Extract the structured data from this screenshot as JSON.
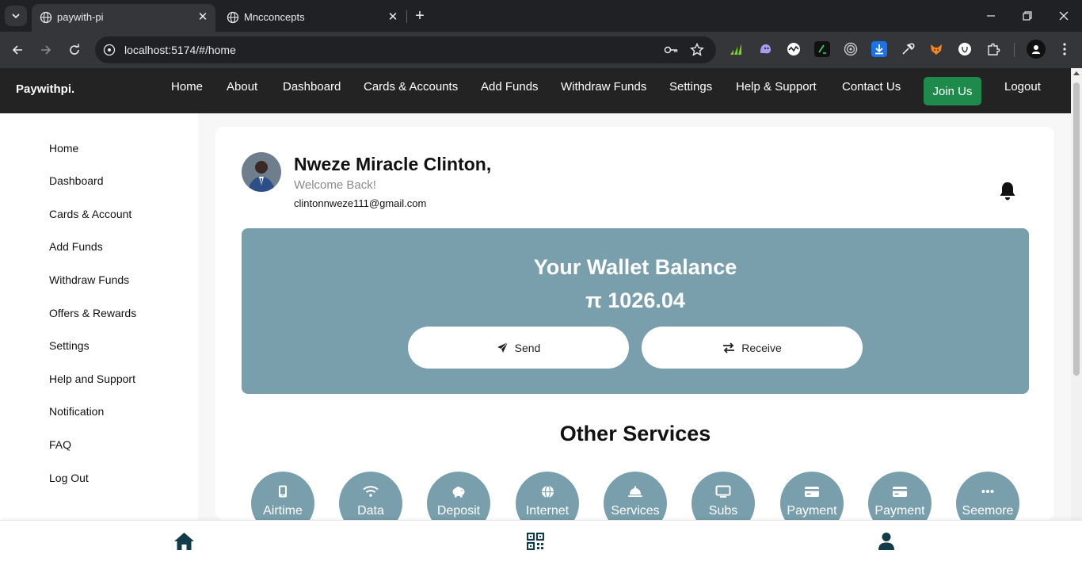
{
  "browser": {
    "tabs": [
      {
        "title": "paywith-pi",
        "active": true
      },
      {
        "title": "Mncconcepts",
        "active": false
      }
    ],
    "url_host": "localhost:5174",
    "url_path": "/#/home"
  },
  "nav": {
    "brand": "Paywithpi.",
    "links": [
      "Home",
      "About",
      "Dashboard",
      "Cards & Accounts",
      "Add Funds",
      "Withdraw Funds",
      "Settings",
      "Help & Support",
      "Contact Us"
    ],
    "join": "Join Us",
    "logout": "Logout"
  },
  "sidebar": {
    "items": [
      "Home",
      "Dashboard",
      "Cards & Account",
      "Add Funds",
      "Withdraw Funds",
      "Offers & Rewards",
      "Settings",
      "Help and Support",
      "Notification",
      "FAQ",
      "Log Out"
    ]
  },
  "user": {
    "name": "Nweze Miracle Clinton,",
    "welcome": "Welcome Back!",
    "email": "clintonnweze111@gmail.com"
  },
  "wallet": {
    "title": "Your Wallet Balance",
    "amount": "π 1026.04",
    "send": "Send",
    "receive": "Receive"
  },
  "services": {
    "title": "Other Services",
    "items": [
      {
        "label": "Airtime",
        "icon": "mobile-icon"
      },
      {
        "label": "Data",
        "icon": "wifi-icon"
      },
      {
        "label": "Deposit",
        "icon": "piggy-bank-icon"
      },
      {
        "label": "Internet",
        "icon": "globe-icon"
      },
      {
        "label": "Services",
        "icon": "service-bell-icon"
      },
      {
        "label": "Subs",
        "icon": "tv-icon"
      },
      {
        "label": "Payment",
        "icon": "credit-card-icon"
      },
      {
        "label": "Payment",
        "icon": "credit-card-icon"
      },
      {
        "label": "Seemore",
        "icon": "ellipsis-icon"
      }
    ]
  },
  "colors": {
    "wallet_bg": "#789fab",
    "nav_bg": "#232323",
    "join_bg": "#1e8a4c",
    "icon_dark": "#123c4a"
  }
}
